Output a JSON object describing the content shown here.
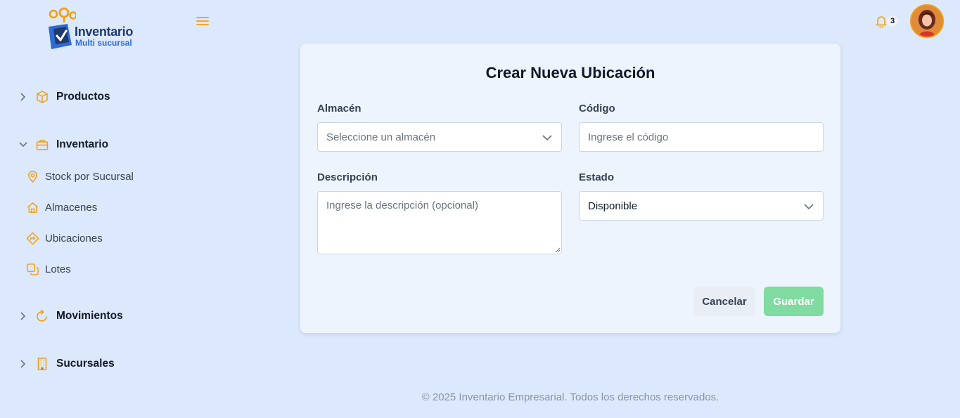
{
  "brand": {
    "title": "Inventario",
    "subtitle": "Multi sucursal"
  },
  "header": {
    "notification_count": "3",
    "colors": {
      "accent": "#f59e0b",
      "brand_blue": "#2e6bd6"
    }
  },
  "sidebar": {
    "groups": [
      {
        "label": "Productos",
        "icon": "box-icon",
        "expanded": false
      },
      {
        "label": "Inventario",
        "icon": "briefcase-icon",
        "expanded": true,
        "items": [
          {
            "label": "Stock por Sucursal",
            "icon": "map-pin-icon"
          },
          {
            "label": "Almacenes",
            "icon": "home-icon"
          },
          {
            "label": "Ubicaciones",
            "icon": "directions-icon"
          },
          {
            "label": "Lotes",
            "icon": "copy-icon"
          }
        ]
      },
      {
        "label": "Movimientos",
        "icon": "refresh-icon",
        "expanded": false
      },
      {
        "label": "Sucursales",
        "icon": "building-icon",
        "expanded": false
      }
    ]
  },
  "form": {
    "title": "Crear Nueva Ubicación",
    "almacen": {
      "label": "Almacén",
      "placeholder": "Seleccione un almacén"
    },
    "codigo": {
      "label": "Código",
      "placeholder": "Ingrese el código"
    },
    "descripcion": {
      "label": "Descripción",
      "placeholder": "Ingrese la descripción (opcional)"
    },
    "estado": {
      "label": "Estado",
      "value": "Disponible"
    },
    "cancel_label": "Cancelar",
    "save_label": "Guardar"
  },
  "footer": {
    "text": "© 2025 Inventario Empresarial. Todos los derechos reservados."
  }
}
